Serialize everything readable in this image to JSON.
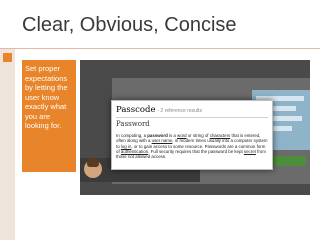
{
  "slide": {
    "title": "Clear, Obvious, Concise",
    "callout_text": "Set proper expectations by letting the user know exactly what you are looking for.",
    "accent_color": "#e8842a",
    "callout_color": "#e8842a"
  },
  "popup": {
    "title": "Passcode",
    "subtitle": "- 2 reference results",
    "term": "Password",
    "definition": {
      "t1": "In computing, a ",
      "bold": "password",
      "t2": " is a ",
      "link1": "word",
      "t3": " or string of ",
      "link2": "characters",
      "t4": " that is entered, often along with a ",
      "link3": "user name",
      "t5": ", in modern times usually into a computer system to ",
      "link4": "log in",
      "t6": ", or to gain access to some resource. Passwords are a common form of ",
      "link5": "authentication",
      "t7": ". Full security requires that the password be kept ",
      "link6": "secret",
      "t8": " from those not allowed access."
    }
  }
}
